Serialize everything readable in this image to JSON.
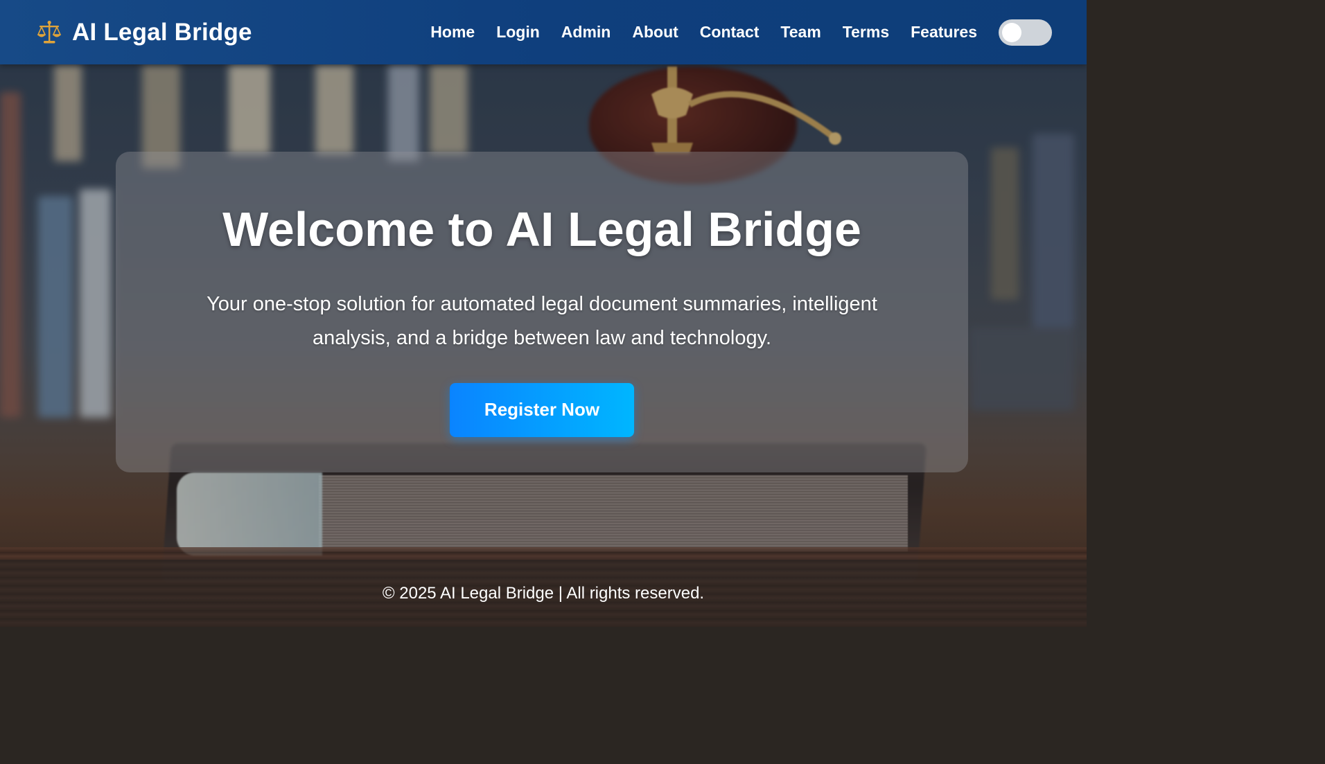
{
  "brand": {
    "icon": "scales-icon",
    "title": "AI Legal Bridge"
  },
  "nav": {
    "links": [
      "Home",
      "Login",
      "Admin",
      "About",
      "Contact",
      "Team",
      "Terms",
      "Features"
    ],
    "theme_toggle": {
      "icon": "toggle-switch",
      "state": "off"
    }
  },
  "hero": {
    "title": "Welcome to AI Legal Bridge",
    "subtitle": "Your one-stop solution for automated legal document summaries, intelligent analysis, and a bridge between law and technology.",
    "cta_label": "Register Now"
  },
  "footer": {
    "text": "© 2025 AI Legal Bridge | All rights reserved."
  },
  "colors": {
    "navbar": "#0f3f7d",
    "cta_start": "#0a84ff",
    "cta_end": "#00b6ff",
    "text": "#ffffff"
  }
}
